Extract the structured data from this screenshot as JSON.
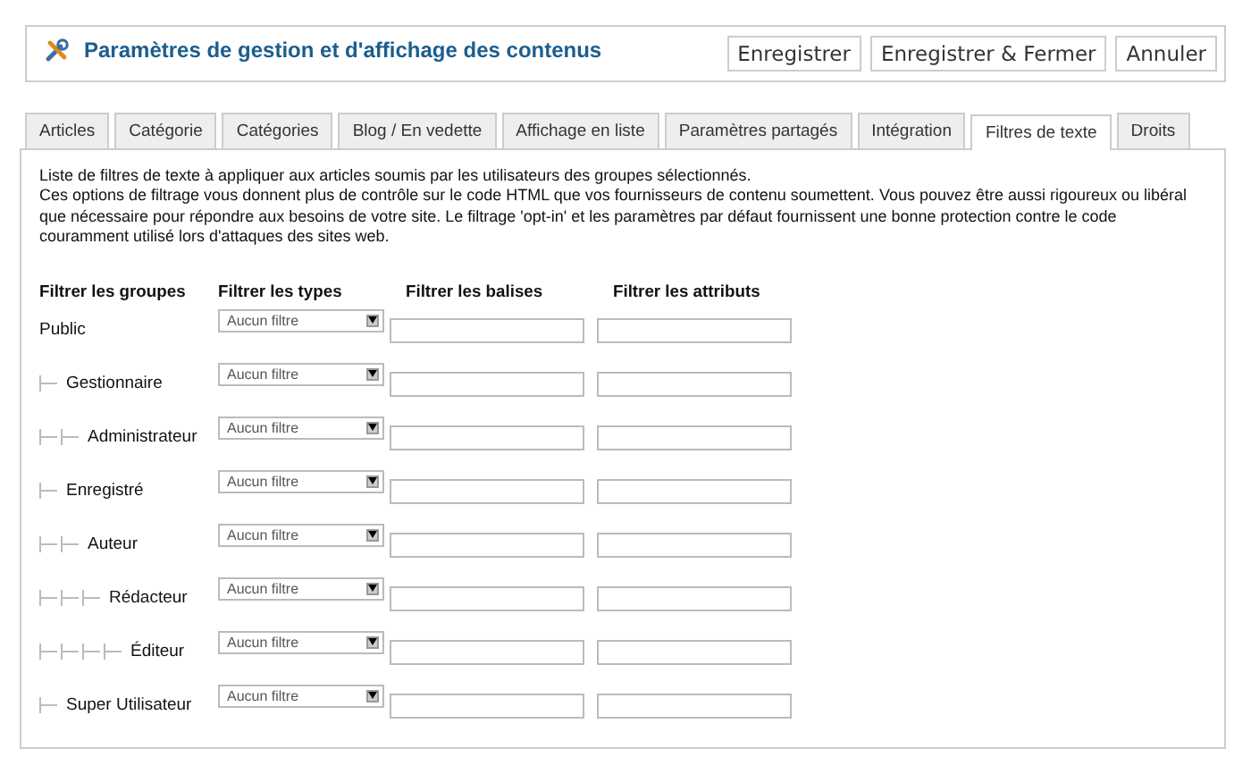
{
  "header": {
    "title": "Paramètres de gestion et d'affichage des contenus",
    "buttons": [
      "Enregistrer",
      "Enregistrer & Fermer",
      "Annuler"
    ]
  },
  "tabs": [
    {
      "label": "Articles",
      "selected": false
    },
    {
      "label": "Catégorie",
      "selected": false
    },
    {
      "label": "Catégories",
      "selected": false
    },
    {
      "label": "Blog / En vedette",
      "selected": false
    },
    {
      "label": "Affichage en liste",
      "selected": false
    },
    {
      "label": "Paramètres partagés",
      "selected": false
    },
    {
      "label": "Intégration",
      "selected": false
    },
    {
      "label": "Filtres de texte",
      "selected": true
    },
    {
      "label": "Droits",
      "selected": false
    }
  ],
  "intro": [
    "Liste de filtres de texte à appliquer aux articles soumis par les utilisateurs des groupes sélectionnés.",
    "Ces options de filtrage vous donnent plus de contrôle sur le code HTML que vos fournisseurs de contenu soumettent. Vous pouvez être aussi rigoureux ou libéral que nécessaire pour répondre aux besoins de votre site. Le filtrage 'opt-in' et les paramètres par défaut fournissent une bonne protection contre le code couramment utilisé lors d'attaques des sites web."
  ],
  "columns": [
    "Filtrer les groupes",
    "Filtrer les types",
    "Filtrer les balises",
    "Filtrer les attributs"
  ],
  "groups": [
    {
      "name": "Public",
      "filter": "Aucun filtre",
      "children": [
        {
          "name": "Gestionnaire",
          "filter": "Aucun filtre",
          "children": [
            {
              "name": "Administrateur",
              "filter": "Aucun filtre"
            }
          ]
        },
        {
          "name": "Enregistré",
          "filter": "Aucun filtre",
          "children": [
            {
              "name": "Auteur",
              "filter": "Aucun filtre",
              "children": [
                {
                  "name": "Rédacteur",
                  "filter": "Aucun filtre",
                  "children": [
                    {
                      "name": "Éditeur",
                      "filter": "Aucun filtre"
                    }
                  ]
                }
              ]
            }
          ]
        },
        {
          "name": "Super Utilisateur",
          "filter": "Aucun filtre"
        }
      ]
    }
  ]
}
